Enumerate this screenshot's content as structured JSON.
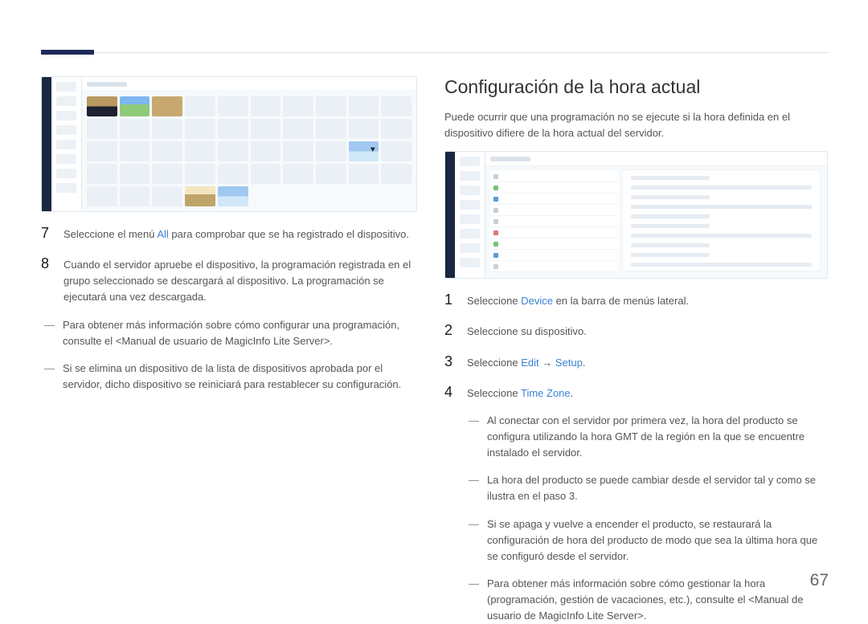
{
  "page_number": "67",
  "left": {
    "step7_num": "7",
    "step7_text_a": "Seleccione el menú ",
    "step7_link": "All",
    "step7_text_b": " para comprobar que se ha registrado el dispositivo.",
    "step8_num": "8",
    "step8_text": "Cuando el servidor apruebe el dispositivo, la programación registrada en el grupo seleccionado se descargará al dispositivo. La programación se ejecutará una vez descargada.",
    "note1": "Para obtener más información sobre cómo configurar una programación, consulte el <Manual de usuario de MagicInfo Lite Server>.",
    "note2": "Si se elimina un dispositivo de la lista de dispositivos aprobada por el servidor, dicho dispositivo se reiniciará para restablecer su configuración."
  },
  "right": {
    "heading": "Configuración de la hora actual",
    "intro": "Puede ocurrir que una programación no se ejecute si la hora definida en el dispositivo difiere de la hora actual del servidor.",
    "step1_num": "1",
    "step1_a": "Seleccione ",
    "step1_link": "Device",
    "step1_b": " en la barra de menús lateral.",
    "step2_num": "2",
    "step2_text": "Seleccione su dispositivo.",
    "step3_num": "3",
    "step3_a": "Seleccione ",
    "step3_link_a": "Edit",
    "step3_arrow": " → ",
    "step3_link_b": "Setup",
    "step3_b": ".",
    "step4_num": "4",
    "step4_a": "Seleccione ",
    "step4_link": "Time Zone",
    "step4_b": ".",
    "note1": "Al conectar con el servidor por primera vez, la hora del producto se configura utilizando la hora GMT de la región en la que se encuentre instalado el servidor.",
    "note2": "La hora del producto se puede cambiar desde el servidor tal y como se ilustra en el paso 3.",
    "note3": "Si se apaga y vuelve a encender el producto, se restaurará la configuración de hora del producto de modo que sea la última hora que se configuró desde el servidor.",
    "note4": "Para obtener más información sobre cómo gestionar la hora (programación, gestión de vacaciones, etc.), consulte el <Manual de usuario de MagicInfo Lite Server>."
  }
}
